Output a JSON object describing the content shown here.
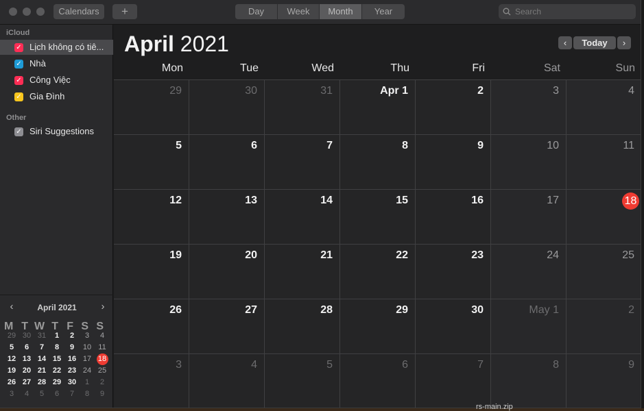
{
  "toolbar": {
    "calendars_label": "Calendars",
    "add_label": "+",
    "views": [
      "Day",
      "Week",
      "Month",
      "Year"
    ],
    "active_view": "Month",
    "search_placeholder": "Search"
  },
  "sidebar": {
    "icloud_header": "iCloud",
    "icloud_items": [
      {
        "label": "Lịch không có tiê...",
        "color": "#ff2d55",
        "selected": true
      },
      {
        "label": "Nhà",
        "color": "#1e9bd7",
        "selected": false
      },
      {
        "label": "Công Việc",
        "color": "#ff2d55",
        "selected": false
      },
      {
        "label": "Gia Đình",
        "color": "#f7c51e",
        "selected": false
      }
    ],
    "other_header": "Other",
    "other_items": [
      {
        "label": "Siri Suggestions",
        "color": "#8e8e93",
        "selected": false
      }
    ]
  },
  "mini_calendar": {
    "title": "April 2021",
    "prev": "‹",
    "next": "›",
    "weekdays": [
      "M",
      "T",
      "W",
      "T",
      "F",
      "S",
      "S"
    ],
    "weeks": [
      [
        "29",
        "30",
        "31",
        "1",
        "2",
        "3",
        "4"
      ],
      [
        "5",
        "6",
        "7",
        "8",
        "9",
        "10",
        "11"
      ],
      [
        "12",
        "13",
        "14",
        "15",
        "16",
        "17",
        "18"
      ],
      [
        "19",
        "20",
        "21",
        "22",
        "23",
        "24",
        "25"
      ],
      [
        "26",
        "27",
        "28",
        "29",
        "30",
        "1",
        "2"
      ],
      [
        "3",
        "4",
        "5",
        "6",
        "7",
        "8",
        "9"
      ]
    ],
    "today": "18"
  },
  "main": {
    "month": "April",
    "year": "2021",
    "prev": "‹",
    "today_label": "Today",
    "next": "›",
    "weekdays": [
      "Mon",
      "Tue",
      "Wed",
      "Thu",
      "Fri",
      "Sat",
      "Sun"
    ],
    "weeks": [
      [
        "29",
        "30",
        "31",
        "Apr 1",
        "2",
        "3",
        "4"
      ],
      [
        "5",
        "6",
        "7",
        "8",
        "9",
        "10",
        "11"
      ],
      [
        "12",
        "13",
        "14",
        "15",
        "16",
        "17",
        "18"
      ],
      [
        "19",
        "20",
        "21",
        "22",
        "23",
        "24",
        "25"
      ],
      [
        "26",
        "27",
        "28",
        "29",
        "30",
        "May 1",
        "2"
      ],
      [
        "3",
        "4",
        "5",
        "6",
        "7",
        "8",
        "9"
      ]
    ],
    "today": "18"
  },
  "desktop_text": "rs-main.zip"
}
